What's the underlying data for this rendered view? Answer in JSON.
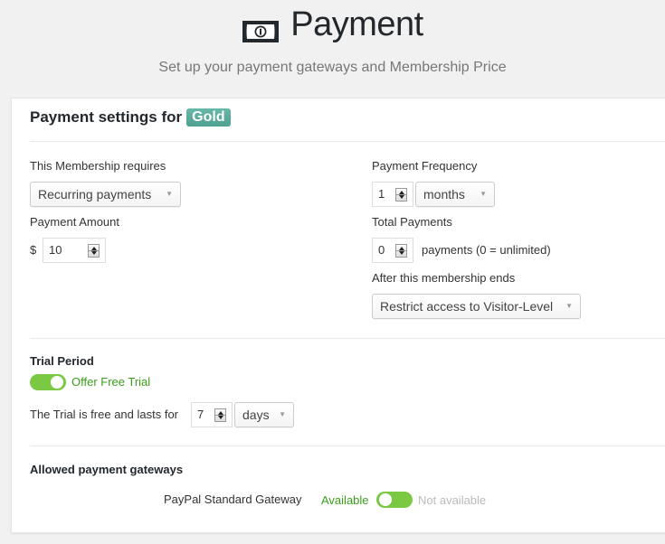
{
  "header": {
    "icon": "money-bill-icon",
    "title": "Payment",
    "subtitle": "Set up your payment gateways and Membership Price"
  },
  "card": {
    "title_prefix": "Payment settings for",
    "membership_badge": "Gold",
    "badge_color": "#5cb0a0"
  },
  "membership_requires": {
    "label": "This Membership requires",
    "selected": "Recurring payments"
  },
  "payment_amount": {
    "label": "Payment Amount",
    "currency": "$",
    "value": "10"
  },
  "payment_frequency": {
    "label": "Payment Frequency",
    "value": "1",
    "unit_selected": "months"
  },
  "total_payments": {
    "label": "Total Payments",
    "value": "0",
    "hint": "payments (0 = unlimited)"
  },
  "after_membership_ends": {
    "label": "After this membership ends",
    "selected": "Restrict access to Visitor-Level"
  },
  "trial": {
    "heading": "Trial Period",
    "toggle_label": "Offer Free Trial",
    "toggle_on": true,
    "duration_label": "The Trial is free and lasts for",
    "duration_value": "7",
    "duration_unit": "days"
  },
  "gateways": {
    "heading": "Allowed payment gateways",
    "items": [
      {
        "name": "PayPal Standard Gateway",
        "available_label": "Available",
        "not_available_label": "Not available",
        "state": "Available"
      }
    ]
  },
  "colors": {
    "toggle_green": "#7bc843",
    "available_text": "#3a9e1c",
    "background": "#f1f1f1"
  }
}
